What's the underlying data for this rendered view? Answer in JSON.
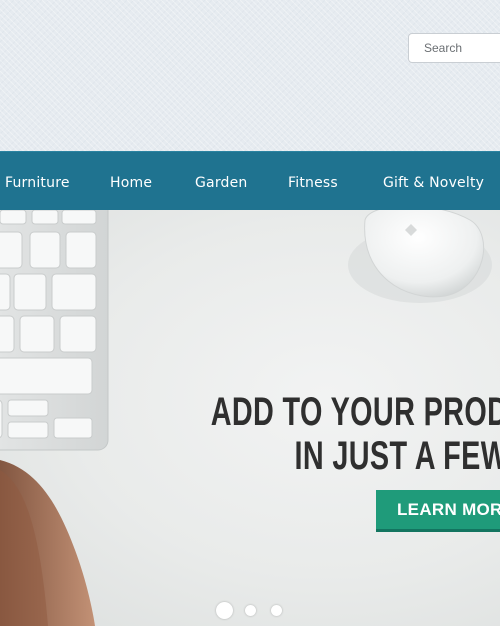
{
  "search": {
    "placeholder": "Search"
  },
  "nav": {
    "items": [
      {
        "label": "Furniture"
      },
      {
        "label": "Home"
      },
      {
        "label": "Garden"
      },
      {
        "label": "Fitness"
      },
      {
        "label": "Gift & Novelty"
      }
    ]
  },
  "hero": {
    "headline_line1": "ADD TO YOUR PROD",
    "headline_line2": "IN JUST A FEW",
    "cta_label": "LEARN MOR",
    "slides_total": 3,
    "active_slide": 1
  },
  "colors": {
    "nav_background": "#1f7390",
    "cta_background": "#1f9b7a",
    "headline_text": "#2f2f2f"
  },
  "icons": [
    "keyboard-image",
    "mouse-image"
  ]
}
